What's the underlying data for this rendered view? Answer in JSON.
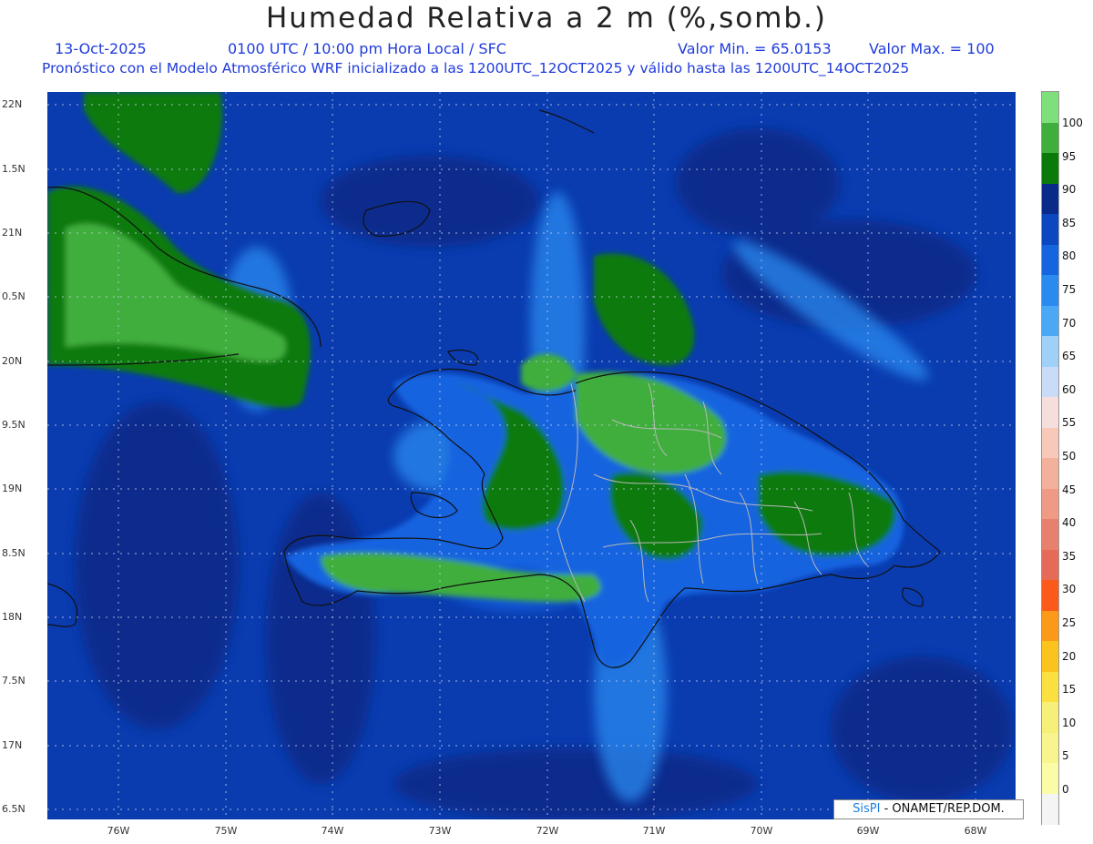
{
  "header": {
    "title": "Humedad Relativa a 2 m (%,somb.)",
    "date": "13-Oct-2025",
    "time": "0100 UTC / 10:00 pm Hora Local / SFC",
    "min": "Valor Min. = 65.0153",
    "max": "Valor Max. = 100",
    "model_line": "Pronóstico con el Modelo Atmosférico WRF inicializado a las 1200UTC_12OCT2025 y válido hasta las  1200UTC_14OCT2025"
  },
  "axes": {
    "lat_labels": [
      "22N",
      "1.5N",
      "21N",
      "0.5N",
      "20N",
      "9.5N",
      "19N",
      "8.5N",
      "18N",
      "7.5N",
      "17N",
      "6.5N"
    ],
    "lon_labels": [
      "76W",
      "75W",
      "74W",
      "73W",
      "72W",
      "71W",
      "70W",
      "69W",
      "68W"
    ]
  },
  "legend": {
    "labels": [
      "100",
      "95",
      "90",
      "85",
      "80",
      "75",
      "70",
      "65",
      "60",
      "55",
      "50",
      "45",
      "40",
      "35",
      "30",
      "25",
      "20",
      "15",
      "10",
      "5",
      "0"
    ],
    "colors": [
      "#7ee07a",
      "#3fae3c",
      "#0a7a0a",
      "#0a2a8a",
      "#0a47c0",
      "#1564e0",
      "#2a8af0",
      "#4aa8f5",
      "#9fd0f8",
      "#c8dcf8",
      "#f5dedc",
      "#f8c8b8",
      "#f3b09a",
      "#ef9a84",
      "#e8806e",
      "#e66a58",
      "#fb5a1a",
      "#fb9a18",
      "#fbc41c",
      "#fbe040",
      "#f6ef78",
      "#f8f58f",
      "#fbfba8",
      "#f4f4f4"
    ]
  },
  "credit": {
    "brand": "SisPI",
    "org": "- ONAMET/REP.DOM."
  }
}
